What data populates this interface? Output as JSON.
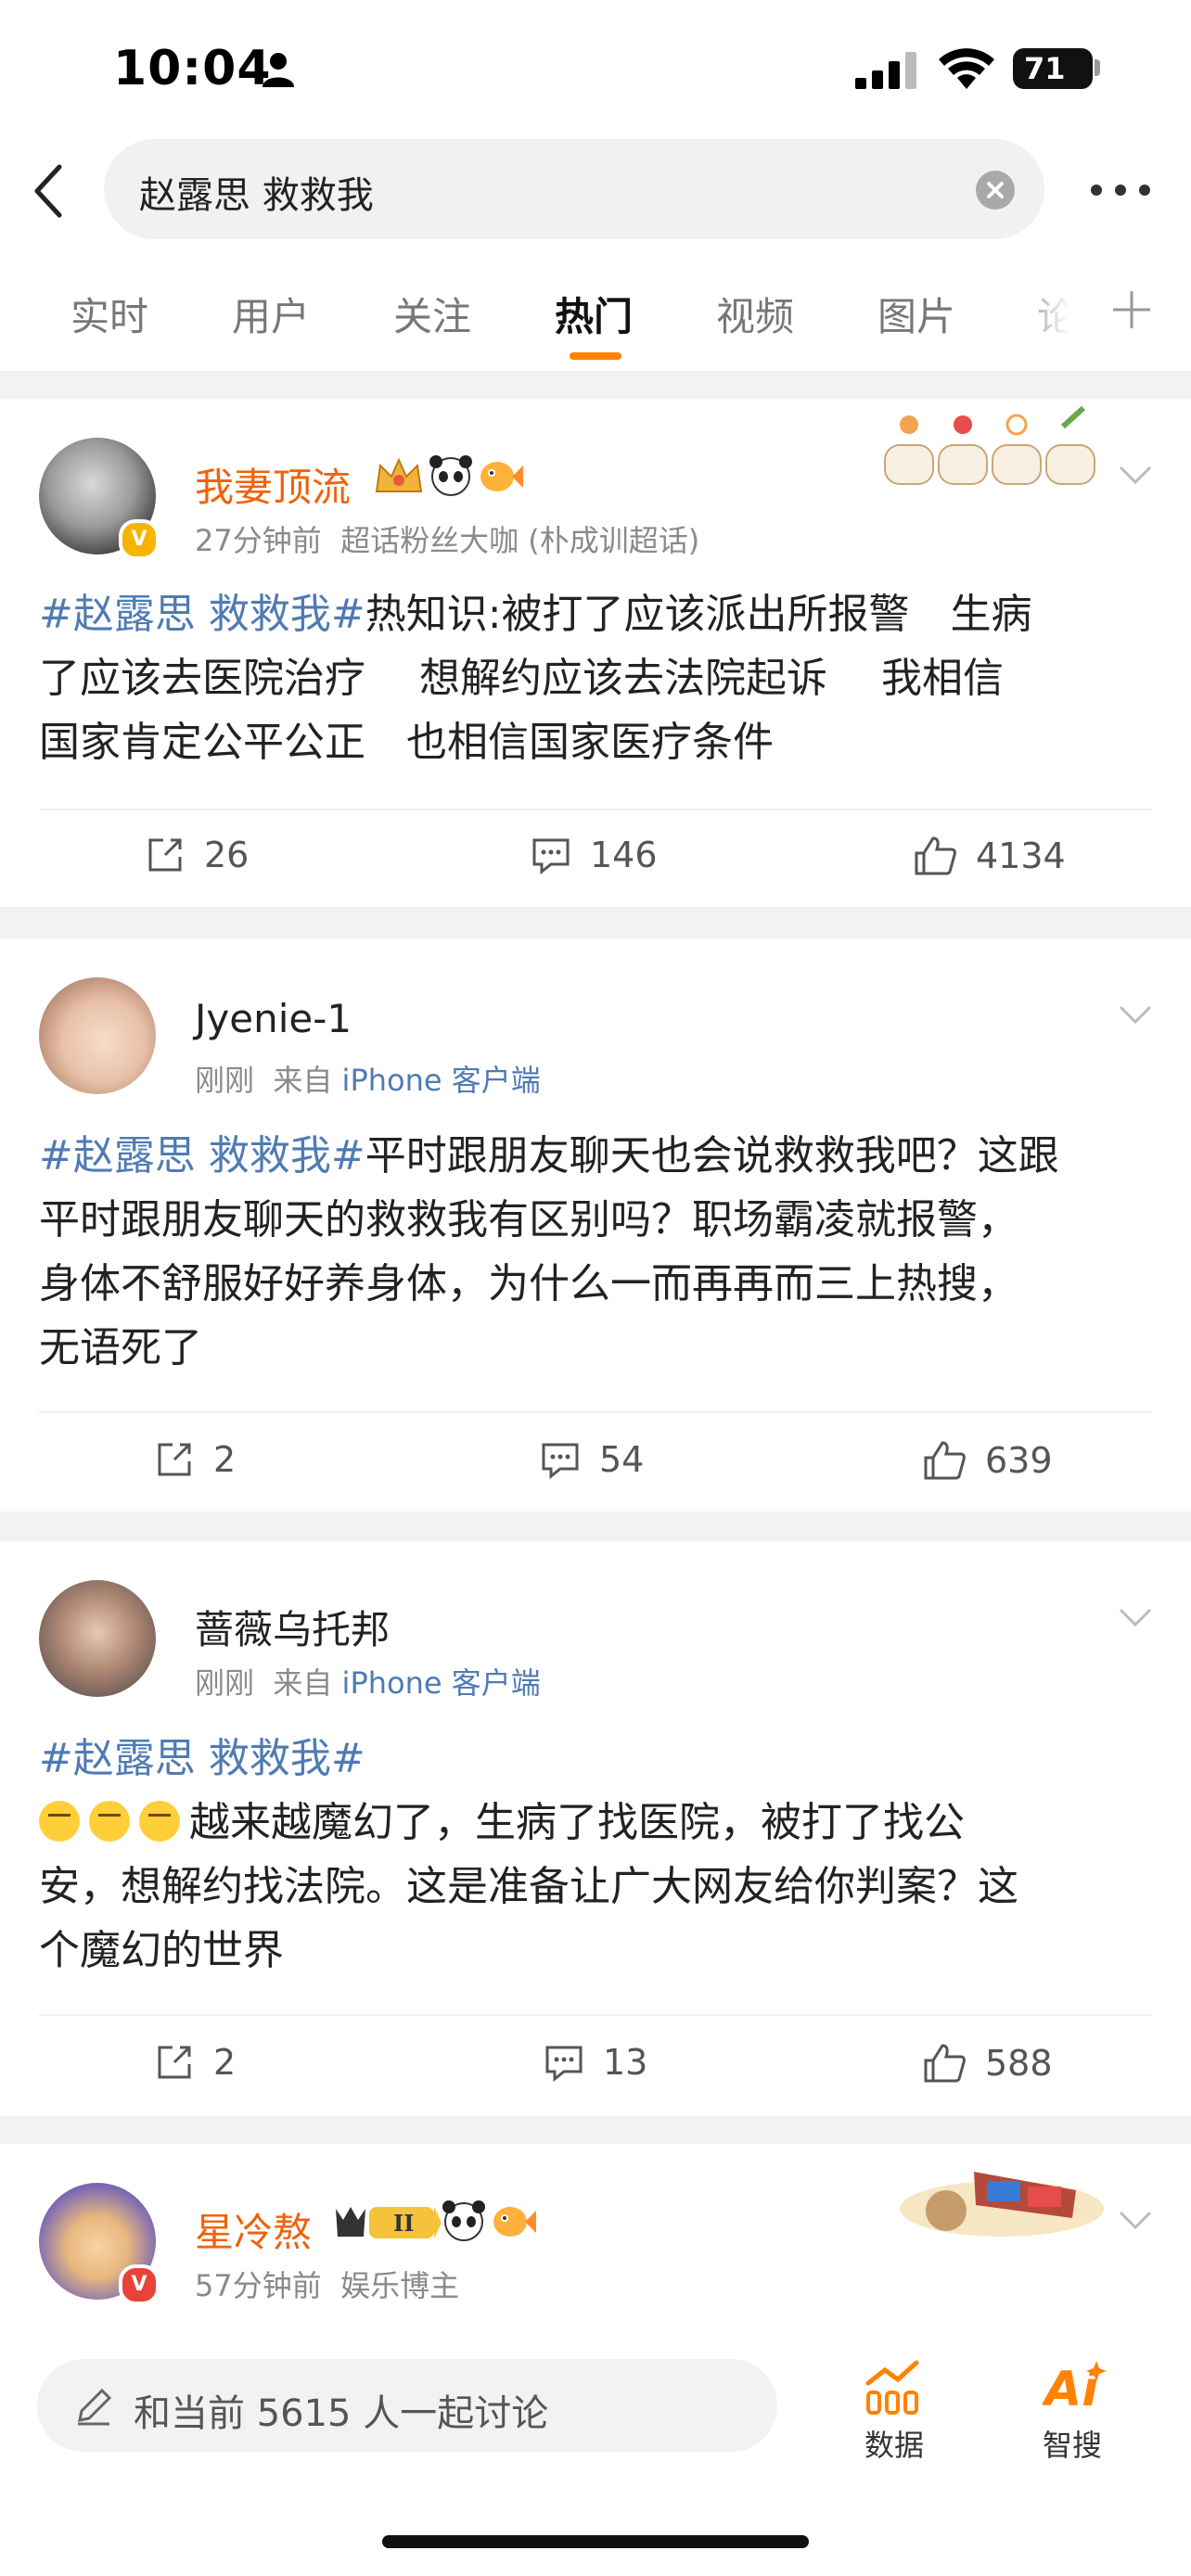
{
  "status": {
    "time": "10:04",
    "battery": "71"
  },
  "search": {
    "query": "赵露思 救救我"
  },
  "tabs": [
    {
      "label": "实时"
    },
    {
      "label": "用户"
    },
    {
      "label": "关注"
    },
    {
      "label": "热门",
      "active": true
    },
    {
      "label": "视频"
    },
    {
      "label": "图片"
    },
    {
      "label": "论"
    }
  ],
  "posts": [
    {
      "username": "我妻顶流",
      "time": "27分钟前",
      "info": "超话粉丝大咖 (朴成训超话)",
      "hashtag": "#赵露思 救救我#",
      "lines": [
        "热知识:被打了应该派出所报警　生病",
        "了应该去医院治疗　 想解约应该去法院起诉　 我相信",
        "国家肯定公平公正　也相信国家医疗条件"
      ],
      "reposts": "26",
      "comments": "146",
      "likes": "4134"
    },
    {
      "username": "Jyenie-1",
      "time": "刚刚",
      "from_prefix": "来自",
      "from": "iPhone 客户端",
      "hashtag": "#赵露思 救救我#",
      "lines": [
        "平时跟朋友聊天也会说救救我吧？这跟",
        "平时跟朋友聊天的救救我有区别吗？职场霸凌就报警，",
        "身体不舒服好好养身体，为什么一而再再而三上热搜，",
        "无语死了"
      ],
      "reposts": "2",
      "comments": "54",
      "likes": "639"
    },
    {
      "username": "蔷薇乌托邦",
      "time": "刚刚",
      "from_prefix": "来自",
      "from": "iPhone 客户端",
      "hashtag": "#赵露思 救救我#",
      "lines": [
        "越来越魔幻了，生病了找医院，被打了找公",
        "安，想解约找法院。这是准备让广大网友给你判案？这",
        "个魔幻的世界"
      ],
      "reposts": "2",
      "comments": "13",
      "likes": "588"
    },
    {
      "username": "星冷熬",
      "time": "57分钟前",
      "info": "娱乐博主",
      "level": "II"
    }
  ],
  "bottom": {
    "discuss": "和当前 5615 人一起讨论",
    "data_label": "数据",
    "ai_label": "智搜"
  },
  "colors": {
    "accent": "#ff8200",
    "link": "#4f7bb3",
    "vip_name": "#f0620a"
  }
}
